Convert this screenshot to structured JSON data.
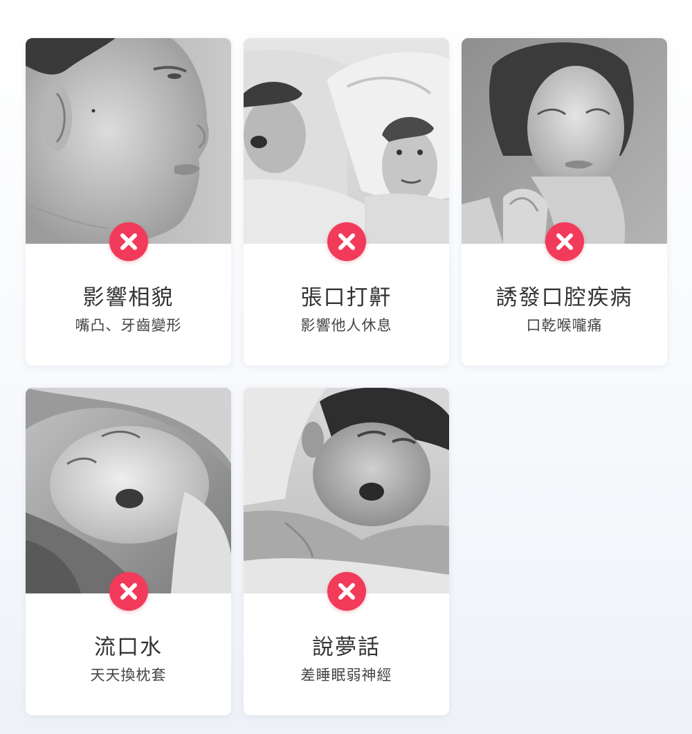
{
  "cards": [
    {
      "title": "影響相貌",
      "subtitle": "嘴凸、牙齒變形",
      "image": "profile-face-photo",
      "icon": "x-icon"
    },
    {
      "title": "張口打鼾",
      "subtitle": "影響他人休息",
      "image": "snoring-couple-photo",
      "icon": "x-icon"
    },
    {
      "title": "誘發口腔疾病",
      "subtitle": "口乾喉嚨痛",
      "image": "sore-throat-woman-photo",
      "icon": "x-icon"
    },
    {
      "title": "流口水",
      "subtitle": "天天換枕套",
      "image": "sleeping-child-photo",
      "icon": "x-icon"
    },
    {
      "title": "說夢話",
      "subtitle": "差睡眠弱神經",
      "image": "sleeping-man-photo",
      "icon": "x-icon"
    }
  ],
  "colors": {
    "badge": "#f23a5a",
    "text": "#333333"
  }
}
